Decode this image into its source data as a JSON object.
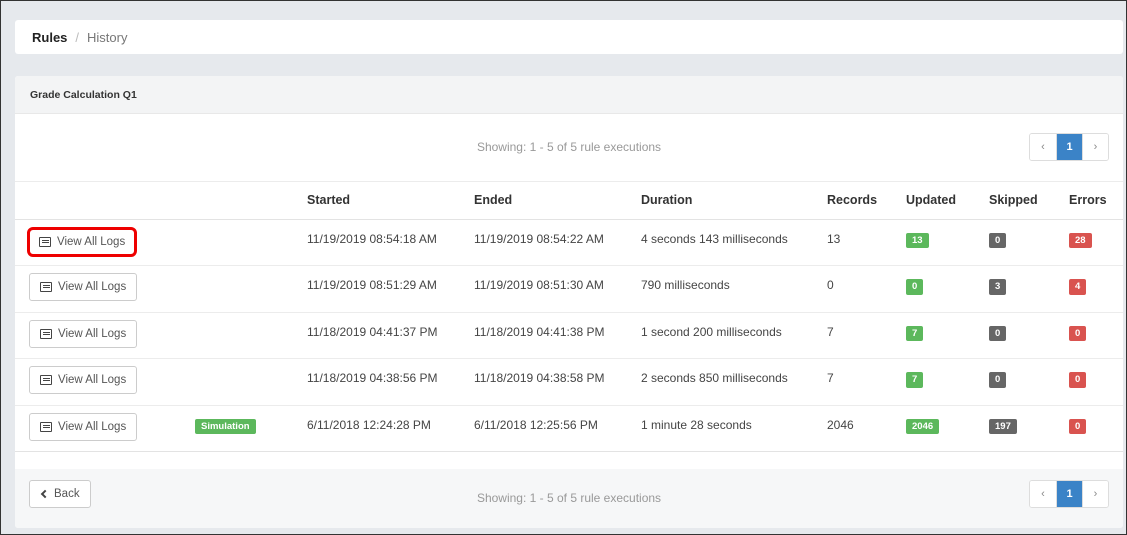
{
  "breadcrumb": {
    "active": "Rules",
    "separator": "/",
    "current": "History"
  },
  "panel": {
    "title": "Grade Calculation Q1"
  },
  "pagination": {
    "showing": "Showing: 1 - 5 of 5 rule executions",
    "prev": "‹",
    "page": "1",
    "next": "›"
  },
  "table": {
    "headers": {
      "started": "Started",
      "ended": "Ended",
      "duration": "Duration",
      "records": "Records",
      "updated": "Updated",
      "skipped": "Skipped",
      "errors": "Errors"
    },
    "button_label": "View All Logs",
    "rows": [
      {
        "tag": "",
        "started": "11/19/2019 08:54:18 AM",
        "ended": "11/19/2019 08:54:22 AM",
        "duration": "4 seconds 143 milliseconds",
        "records": "13",
        "updated": "13",
        "skipped": "0",
        "errors": "28"
      },
      {
        "tag": "",
        "started": "11/19/2019 08:51:29 AM",
        "ended": "11/19/2019 08:51:30 AM",
        "duration": "790 milliseconds",
        "records": "0",
        "updated": "0",
        "skipped": "3",
        "errors": "4"
      },
      {
        "tag": "",
        "started": "11/18/2019 04:41:37 PM",
        "ended": "11/18/2019 04:41:38 PM",
        "duration": "1 second 200 milliseconds",
        "records": "7",
        "updated": "7",
        "skipped": "0",
        "errors": "0"
      },
      {
        "tag": "",
        "started": "11/18/2019 04:38:56 PM",
        "ended": "11/18/2019 04:38:58 PM",
        "duration": "2 seconds 850 milliseconds",
        "records": "7",
        "updated": "7",
        "skipped": "0",
        "errors": "0"
      },
      {
        "tag": "Simulation",
        "started": "6/11/2018 12:24:28 PM",
        "ended": "6/11/2018 12:25:56 PM",
        "duration": "1 minute 28 seconds",
        "records": "2046",
        "updated": "2046",
        "skipped": "197",
        "errors": "0"
      }
    ]
  },
  "footer": {
    "back_label": "Back"
  },
  "colors": {
    "updated": "#5cb85c",
    "skipped": "#666666",
    "errors": "#d9534f",
    "page_active": "#3b83c7",
    "highlight": "#ee0000"
  }
}
